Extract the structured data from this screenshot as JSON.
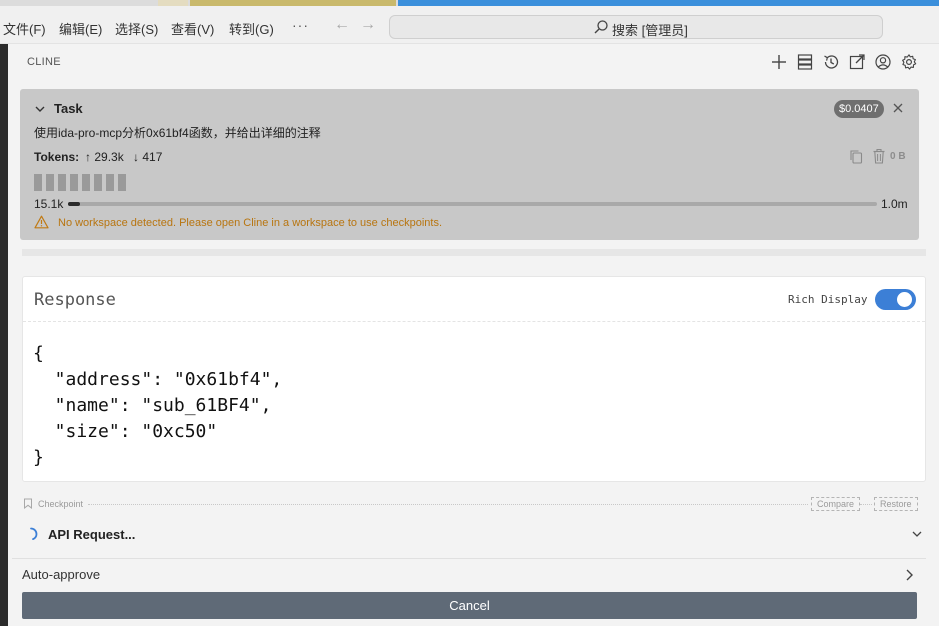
{
  "menubar": {
    "items": [
      "文件(F)",
      "编辑(E)",
      "选择(S)",
      "查看(V)",
      "转到(G)"
    ],
    "more": "···",
    "search": "搜索 [管理员]"
  },
  "panel": {
    "title": "CLINE",
    "icons": [
      "plus-icon",
      "server-icon",
      "history-icon",
      "popout-icon",
      "account-icon",
      "settings-icon"
    ]
  },
  "task": {
    "title": "Task",
    "cost": "$0.0407",
    "description": "使用ida-pro-mcp分析0x61bf4函数，并给出详细的注释",
    "tokens_label": "Tokens:",
    "tokens_in": "29.3k",
    "tokens_out": "417",
    "size": "0 B",
    "context_used": "15.1k",
    "context_total": "1.0m",
    "context_fraction": 0.015,
    "warning": "No workspace detected. Please open Cline in a workspace to use checkpoints."
  },
  "response": {
    "title": "Response",
    "rich_display_label": "Rich Display",
    "rich_display_on": true,
    "json_text": "{\n  \"address\": \"0x61bf4\",\n  \"name\": \"sub_61BF4\",\n  \"size\": \"0xc50\"\n}"
  },
  "checkpoint": {
    "label": "Checkpoint",
    "compare": "Compare",
    "restore": "Restore"
  },
  "api_request": {
    "label": "API Request..."
  },
  "auto_approve": {
    "label": "Auto-approve"
  },
  "cancel": {
    "label": "Cancel"
  },
  "colors": {
    "accent": "#3c7fd6",
    "warning": "#b87510",
    "cancel_bg": "#5f6a77",
    "task_bg": "#c8c8c8"
  }
}
